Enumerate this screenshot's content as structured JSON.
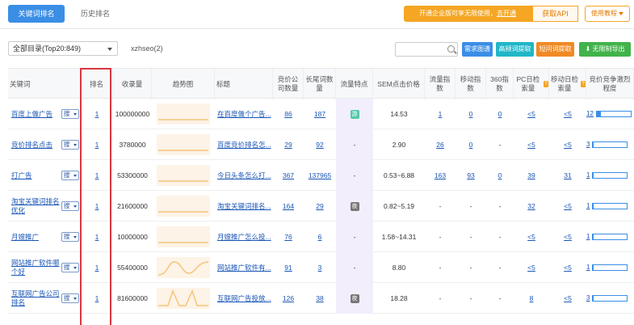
{
  "tabs": {
    "active": "关键词排名",
    "inactive": "历史排名"
  },
  "notice": {
    "text": "开通企业版可享无限使用，",
    "link": "去开通"
  },
  "get_api": "获取API",
  "tutorial": "使用教程",
  "filter": {
    "directory": "全部目录(Top20:849)",
    "site": "xzhseo(2)"
  },
  "buttons": {
    "demand": "需求图谱",
    "freq": "高频词提取",
    "short": "短问词提取",
    "export": "无限制导出"
  },
  "columns": [
    "关键词",
    "排名",
    "收录量",
    "趋势图",
    "标题",
    "竞价公司数量",
    "长尾词数量",
    "流量特点",
    "SEM点击价格",
    "流量指数",
    "移动指数",
    "360指数",
    "PC日检索量",
    "移动日检索量",
    "竞价竞争激烈程度"
  ],
  "sou_label": "搜",
  "rows": [
    {
      "keyword": "百度上做广告",
      "rank": "1",
      "indexed": "100000000",
      "title": "在百度做个广告...",
      "bid_companies": "86",
      "longtail": "187",
      "flow_tag": "游",
      "flow_tag_color": "#52c9a9",
      "sem": "14.53",
      "flow_idx": "1",
      "mobile_idx": "0",
      "idx360": "0",
      "pc_daily": "<5",
      "mobile_daily": "<5",
      "compete": "12",
      "compete_fill": 0.12,
      "trend": "flat"
    },
    {
      "keyword": "竞价排名点击",
      "rank": "1",
      "indexed": "3780000",
      "title": "百度竞价排名怎...",
      "bid_companies": "29",
      "longtail": "92",
      "flow_tag": "-",
      "flow_tag_color": "",
      "sem": "2.90",
      "flow_idx": "26",
      "mobile_idx": "0",
      "idx360": "-",
      "pc_daily": "<5",
      "mobile_daily": "<5",
      "compete": "3",
      "compete_fill": 0.03,
      "trend": "flat"
    },
    {
      "keyword": "打广告",
      "rank": "1",
      "indexed": "53300000",
      "title": "今日头条怎么打...",
      "bid_companies": "367",
      "longtail": "137965",
      "flow_tag": "-",
      "flow_tag_color": "",
      "sem": "0.53~6.88",
      "flow_idx": "163",
      "mobile_idx": "93",
      "idx360": "0",
      "pc_daily": "39",
      "mobile_daily": "31",
      "compete": "1",
      "compete_fill": 0.01,
      "trend": "flat"
    },
    {
      "keyword": "淘宝关键词排名优化",
      "rank": "1",
      "indexed": "21600000",
      "title": "淘宝关键词排名...",
      "bid_companies": "164",
      "longtail": "29",
      "flow_tag": "夜",
      "flow_tag_color": "#777777",
      "sem": "0.82~5.19",
      "flow_idx": "-",
      "mobile_idx": "-",
      "idx360": "-",
      "pc_daily": "32",
      "mobile_daily": "<5",
      "compete": "1",
      "compete_fill": 0.01,
      "trend": "flat"
    },
    {
      "keyword": "月嫂推广",
      "rank": "1",
      "indexed": "10000000",
      "title": "月嫂推广怎么投...",
      "bid_companies": "76",
      "longtail": "6",
      "flow_tag": "-",
      "flow_tag_color": "",
      "sem": "1.58~14.31",
      "flow_idx": "-",
      "mobile_idx": "-",
      "idx360": "-",
      "pc_daily": "<5",
      "mobile_daily": "<5",
      "compete": "1",
      "compete_fill": 0.01,
      "trend": "flat"
    },
    {
      "keyword": "网站推广软件哪个好",
      "rank": "1",
      "indexed": "55400000",
      "title": "网站推广软件有...",
      "bid_companies": "91",
      "longtail": "3",
      "flow_tag": "-",
      "flow_tag_color": "",
      "sem": "8.80",
      "flow_idx": "-",
      "mobile_idx": "-",
      "idx360": "-",
      "pc_daily": "<5",
      "mobile_daily": "<5",
      "compete": "1",
      "compete_fill": 0.01,
      "trend": "wave"
    },
    {
      "keyword": "互联网广告公司排名",
      "rank": "1",
      "indexed": "81600000",
      "title": "互联网广告投放...",
      "bid_companies": "126",
      "longtail": "38",
      "flow_tag": "夜",
      "flow_tag_color": "#777777",
      "sem": "18.28",
      "flow_idx": "-",
      "mobile_idx": "-",
      "idx360": "-",
      "pc_daily": "8",
      "mobile_daily": "<5",
      "compete": "3",
      "compete_fill": 0.03,
      "trend": "spike"
    }
  ]
}
